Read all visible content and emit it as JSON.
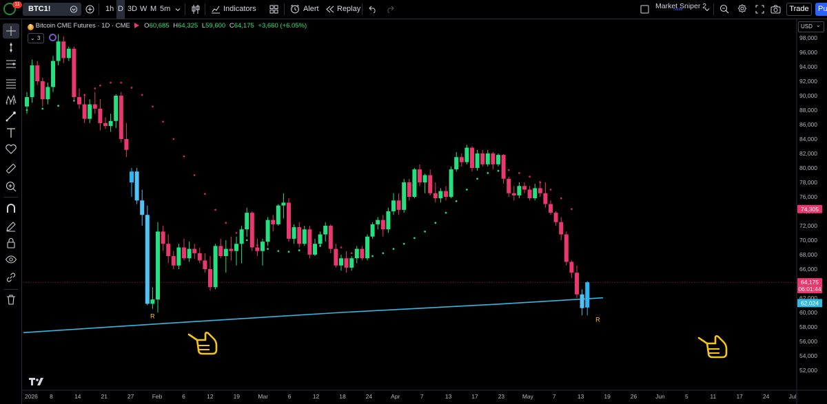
{
  "toolbar": {
    "alerts_badge": "11",
    "symbol": "BTC1!",
    "intervals": [
      "1h",
      "D",
      "3D",
      "W",
      "M",
      "5m"
    ],
    "active_interval": "D",
    "indicators": "Indicators",
    "alert": "Alert",
    "replay": "Replay",
    "layout_name": "Market Sniper 2",
    "layout_sub": "Save",
    "trade": "Trade",
    "publish": "Pu"
  },
  "legend": {
    "title": "Bitcoin CME Futures · 1D · CME",
    "o_label": "O",
    "o": "60,685",
    "h_label": "H",
    "h": "64,325",
    "l_label": "L",
    "l": "59,600",
    "c_label": "C",
    "c": "64,175",
    "chg": "+3,660 (+6.05%)",
    "indicator_count": "3"
  },
  "price_axis": {
    "currency": "USD",
    "last_price": "64,175",
    "countdown": "06:01:44",
    "ma_value": "62,024",
    "sar_value": "74,305"
  },
  "colors": {
    "up": "#26e07f",
    "down": "#e8386d",
    "hl_up": "#29b6f6",
    "hl_down": "#4fc3f7",
    "ma": "#35b8e0",
    "sar_bull": "#1ed882",
    "sar_bear": "#c8294f",
    "label_r": "#f5c518"
  },
  "chart_data": {
    "type": "candlestick",
    "symbol": "BTC1!",
    "timeframe": "1D",
    "ylim": [
      51000,
      99000
    ],
    "y_ticks": [
      52000,
      54000,
      56000,
      58000,
      60000,
      62000,
      64000,
      66000,
      68000,
      70000,
      72000,
      74000,
      76000,
      78000,
      80000,
      82000,
      84000,
      86000,
      88000,
      90000,
      92000,
      94000,
      96000,
      98000
    ],
    "x_tick_labels": [
      "2026",
      "8",
      "14",
      "21",
      "27",
      "Feb",
      "6",
      "12",
      "19",
      "Mar",
      "6",
      "12",
      "18",
      "24",
      "Apr",
      "7",
      "13",
      "17",
      "23",
      "May",
      "7",
      "13",
      "19",
      "26",
      "Jun",
      "5",
      "11",
      "17",
      "24",
      "Jul"
    ],
    "candles": [
      [
        88500,
        90500,
        87500,
        89800
      ],
      [
        89800,
        95000,
        89000,
        94200
      ],
      [
        94200,
        94800,
        91500,
        92000
      ],
      [
        92000,
        92500,
        88500,
        89500
      ],
      [
        89500,
        91800,
        88800,
        91200
      ],
      [
        91200,
        95500,
        90500,
        94800
      ],
      [
        94800,
        98500,
        94200,
        97500
      ],
      [
        97500,
        98200,
        94500,
        95200
      ],
      [
        95200,
        96800,
        94800,
        96500
      ],
      [
        96500,
        96800,
        89200,
        89800
      ],
      [
        89800,
        91000,
        88200,
        88800
      ],
      [
        88800,
        90200,
        86200,
        86800
      ],
      [
        86800,
        89500,
        86200,
        88800
      ],
      [
        88800,
        90500,
        87500,
        88200
      ],
      [
        88200,
        89500,
        85200,
        86200
      ],
      [
        86200,
        87000,
        85400,
        85800
      ],
      [
        85800,
        87500,
        85000,
        86500
      ],
      [
        86500,
        90200,
        85500,
        90000
      ],
      [
        90000,
        90500,
        83500,
        84000
      ],
      [
        84000,
        86200,
        81500,
        82500
      ],
      [
        78000,
        80000,
        76000,
        79500
      ],
      [
        79500,
        80000,
        75000,
        75500
      ],
      [
        75500,
        77000,
        72000,
        73500
      ],
      [
        73500,
        74800,
        61000,
        61200
      ],
      [
        61200,
        63500,
        60500,
        61800
      ],
      [
        61800,
        72500,
        60000,
        71200
      ],
      [
        71200,
        72000,
        68500,
        69500
      ],
      [
        69500,
        70800,
        66800,
        67800
      ],
      [
        67800,
        68500,
        66000,
        66500
      ],
      [
        66500,
        69500,
        66000,
        69000
      ],
      [
        69000,
        70200,
        67200,
        67500
      ],
      [
        67500,
        69800,
        67000,
        68800
      ],
      [
        68800,
        69500,
        67400,
        68200
      ],
      [
        68200,
        69000,
        66800,
        67200
      ],
      [
        67200,
        68200,
        65500,
        66000
      ],
      [
        66000,
        67800,
        63000,
        63500
      ],
      [
        63500,
        69500,
        63200,
        69200
      ],
      [
        69200,
        70200,
        67500,
        67800
      ],
      [
        67800,
        70000,
        65500,
        68800
      ],
      [
        68800,
        70500,
        67200,
        68500
      ],
      [
        68500,
        70500,
        66500,
        69500
      ],
      [
        69500,
        72000,
        66800,
        71500
      ],
      [
        71500,
        74500,
        70500,
        73800
      ],
      [
        73800,
        74000,
        68500,
        69000
      ],
      [
        69000,
        70200,
        67800,
        68500
      ],
      [
        68500,
        70200,
        66500,
        69800
      ],
      [
        69800,
        73200,
        69200,
        72800
      ],
      [
        72800,
        73500,
        71200,
        72200
      ],
      [
        72200,
        75000,
        72000,
        74800
      ],
      [
        74800,
        76500,
        73000,
        75200
      ],
      [
        75200,
        75800,
        69800,
        70200
      ],
      [
        70200,
        72200,
        69500,
        71800
      ],
      [
        71800,
        72500,
        69000,
        69500
      ],
      [
        69500,
        72000,
        69200,
        71500
      ],
      [
        71500,
        72000,
        67500,
        68000
      ],
      [
        68000,
        70200,
        67800,
        69500
      ],
      [
        69500,
        71200,
        69200,
        70800
      ],
      [
        70800,
        72500,
        69800,
        72000
      ],
      [
        72000,
        72200,
        68200,
        68800
      ],
      [
        68800,
        69500,
        66200,
        66500
      ],
      [
        66500,
        68000,
        65800,
        67500
      ],
      [
        67500,
        68500,
        65500,
        66200
      ],
      [
        66200,
        67800,
        65800,
        67500
      ],
      [
        67500,
        69200,
        66800,
        68800
      ],
      [
        68800,
        69200,
        67200,
        67500
      ],
      [
        67500,
        70800,
        67200,
        70500
      ],
      [
        70500,
        72500,
        70200,
        72200
      ],
      [
        72200,
        73200,
        71500,
        72800
      ],
      [
        72800,
        73500,
        70500,
        71500
      ],
      [
        71500,
        74500,
        71000,
        74000
      ],
      [
        74000,
        76500,
        73500,
        75500
      ],
      [
        75500,
        76500,
        73500,
        74200
      ],
      [
        74200,
        78500,
        73800,
        78000
      ],
      [
        78000,
        78500,
        75500,
        76000
      ],
      [
        76000,
        80000,
        75800,
        79800
      ],
      [
        79800,
        80500,
        77500,
        78000
      ],
      [
        78000,
        79200,
        76500,
        79000
      ],
      [
        79000,
        79800,
        76200,
        76500
      ],
      [
        76500,
        78000,
        75200,
        75800
      ],
      [
        75800,
        77200,
        75200,
        76800
      ],
      [
        76800,
        77500,
        75500,
        76000
      ],
      [
        76000,
        80200,
        75800,
        79800
      ],
      [
        79800,
        82200,
        79500,
        81500
      ],
      [
        81500,
        82000,
        80200,
        80800
      ],
      [
        80800,
        83200,
        80500,
        82800
      ],
      [
        82800,
        83000,
        79500,
        80000
      ],
      [
        80000,
        82500,
        79600,
        82000
      ],
      [
        82000,
        82500,
        80200,
        80500
      ],
      [
        80500,
        82500,
        80200,
        82000
      ],
      [
        82000,
        82200,
        79800,
        80500
      ],
      [
        80500,
        82000,
        80200,
        81800
      ],
      [
        81800,
        81900,
        77800,
        78500
      ],
      [
        78500,
        78800,
        76000,
        76500
      ],
      [
        76500,
        77500,
        75500,
        76200
      ],
      [
        76200,
        78000,
        75800,
        77500
      ],
      [
        77500,
        78000,
        76500,
        77000
      ],
      [
        77000,
        77500,
        75500,
        75800
      ],
      [
        75800,
        77800,
        75500,
        77200
      ],
      [
        77200,
        78200,
        76000,
        76500
      ],
      [
        76500,
        78000,
        74500,
        75000
      ],
      [
        75000,
        75500,
        73500,
        73800
      ],
      [
        73800,
        74000,
        72000,
        72500
      ],
      [
        72500,
        73200,
        70000,
        70800
      ],
      [
        70800,
        71200,
        66500,
        67000
      ],
      [
        67000,
        67200,
        64800,
        65500
      ],
      [
        65500,
        66500,
        62000,
        62500
      ],
      [
        62500,
        63200,
        59600,
        60600
      ],
      [
        60685,
        64325,
        59600,
        64175
      ]
    ],
    "ma_series": [
      [
        0,
        57250
      ],
      [
        30,
        58650
      ],
      [
        60,
        60000
      ],
      [
        90,
        61150
      ],
      [
        110,
        62024
      ]
    ],
    "sar_series": [
      [
        0,
        88000
      ],
      [
        3,
        88200
      ],
      [
        6,
        88600
      ],
      [
        9,
        89300
      ],
      [
        11,
        90100
      ],
      [
        13,
        91000
      ],
      [
        14,
        91400
      ],
      [
        16,
        91800
      ],
      [
        18,
        91800
      ],
      [
        20,
        91100
      ],
      [
        22,
        90100
      ],
      [
        24,
        88500
      ],
      [
        26,
        86400
      ],
      [
        28,
        84000
      ],
      [
        30,
        81600
      ],
      [
        32,
        79000
      ],
      [
        34,
        76400
      ],
      [
        36,
        74200
      ],
      [
        38,
        72400
      ],
      [
        40,
        71000
      ],
      [
        42,
        70000
      ],
      [
        44,
        69300
      ],
      [
        46,
        68800
      ],
      [
        48,
        68500
      ],
      [
        50,
        68400
      ],
      [
        52,
        68600
      ],
      [
        54,
        69200
      ],
      [
        56,
        69200
      ],
      [
        58,
        69300
      ],
      [
        60,
        69000
      ],
      [
        62,
        68200
      ],
      [
        64,
        67800
      ],
      [
        66,
        67800
      ],
      [
        68,
        68200
      ],
      [
        70,
        68800
      ],
      [
        72,
        69500
      ],
      [
        74,
        70300
      ],
      [
        76,
        71200
      ],
      [
        78,
        72400
      ],
      [
        80,
        73800
      ],
      [
        82,
        75400
      ],
      [
        84,
        77000
      ],
      [
        86,
        78500
      ],
      [
        88,
        79300
      ],
      [
        90,
        79600
      ],
      [
        92,
        79700
      ],
      [
        94,
        79300
      ],
      [
        96,
        78800
      ],
      [
        98,
        78000
      ],
      [
        100,
        77000
      ],
      [
        102,
        75800
      ],
      [
        104,
        74305
      ]
    ],
    "highlight_candles": [
      20,
      21,
      22,
      23,
      106,
      107,
      108
    ],
    "annotations": [
      {
        "text": "R",
        "index": 24,
        "price": 59200
      },
      {
        "text": "R",
        "index": 109,
        "price": 58700
      }
    ],
    "grid": false,
    "scale": "linear"
  }
}
